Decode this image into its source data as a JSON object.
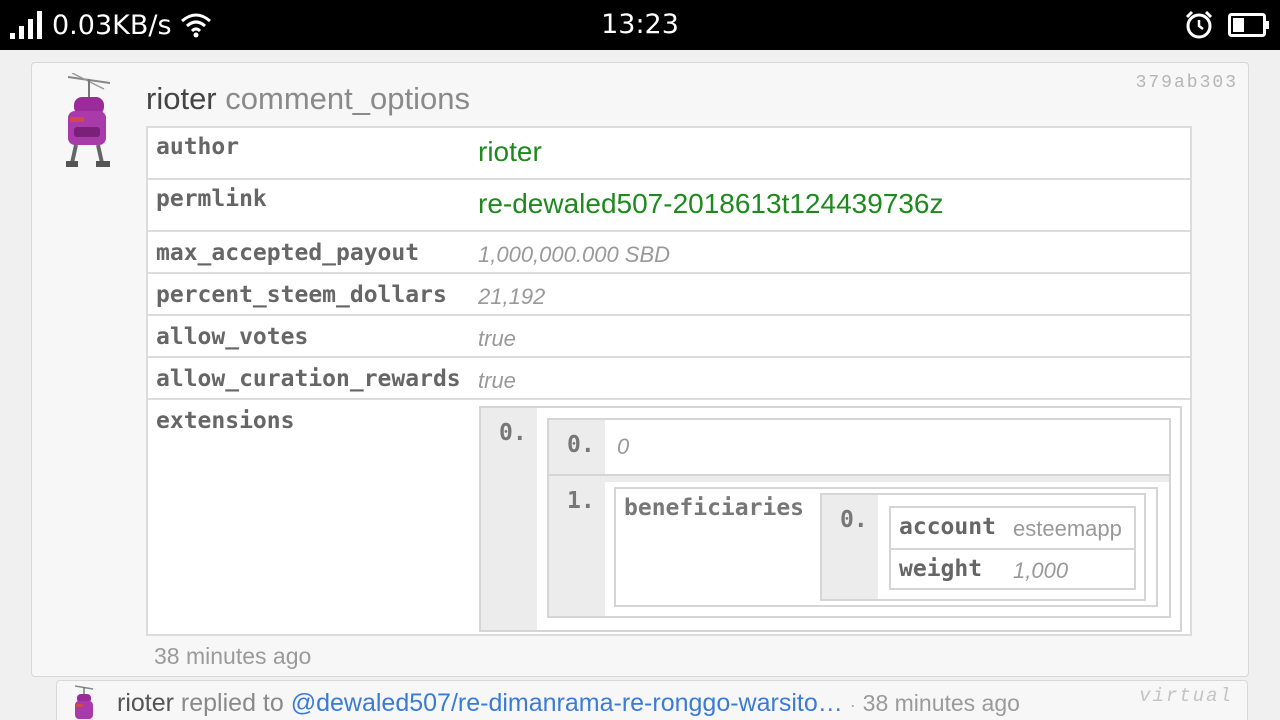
{
  "status_bar": {
    "network_speed": "0.03KB/s",
    "time": "13:23",
    "icons": [
      "signal-icon",
      "wifi-icon",
      "alarm-icon",
      "battery-icon"
    ]
  },
  "operation": {
    "trx_id": "379ab303",
    "author": "rioter",
    "type": "comment_options",
    "time_ago": "38 minutes ago",
    "fields": {
      "author_key": "author",
      "author_value": "rioter",
      "permlink_key": "permlink",
      "permlink_value": "re-dewaled507-2018613t124439736z",
      "max_payout_key": "max_accepted_payout",
      "max_payout_value": "1,000,000.000 SBD",
      "percent_key": "percent_steem_dollars",
      "percent_value": "21,192",
      "allow_votes_key": "allow_votes",
      "allow_votes_value": "true",
      "allow_curation_key": "allow_curation_rewards",
      "allow_curation_value": "true",
      "extensions_key": "extensions"
    },
    "extensions": {
      "outer_index": "0.",
      "item0_index": "0.",
      "item0_value": "0",
      "item1_index": "1.",
      "beneficiaries_key": "beneficiaries",
      "beneficiary_index": "0.",
      "account_key": "account",
      "account_value": "esteemapp",
      "weight_key": "weight",
      "weight_value": "1,000"
    }
  },
  "next_item": {
    "author": "rioter",
    "replied_to": "replied to",
    "link": "@dewaled507/re-dimanrama-re-ronggo-warsito…",
    "separator": "·",
    "time_ago": "38 minutes ago",
    "tag": "virtual"
  },
  "colors": {
    "value_green": "#1e8a1e",
    "link_blue": "#3a7bd5",
    "avatar_purple": "#9b2a9b"
  }
}
